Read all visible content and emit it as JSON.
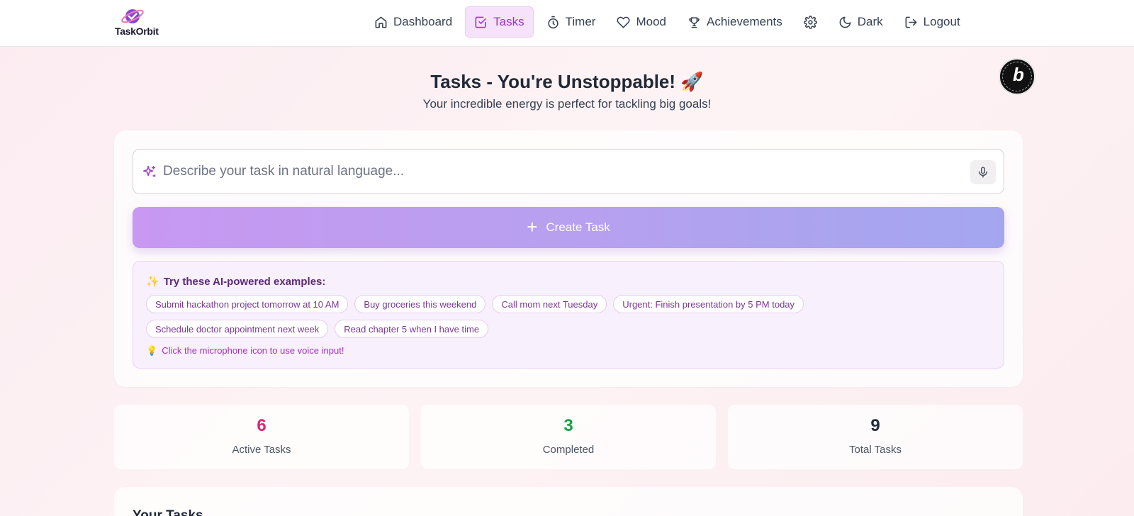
{
  "app": {
    "name": "TaskOrbit"
  },
  "nav": {
    "items": [
      {
        "label": "Dashboard",
        "icon": "home-icon",
        "active": false
      },
      {
        "label": "Tasks",
        "icon": "checkbox-icon",
        "active": true
      },
      {
        "label": "Timer",
        "icon": "stopwatch-icon",
        "active": false
      },
      {
        "label": "Mood",
        "icon": "heart-icon",
        "active": false
      },
      {
        "label": "Achievements",
        "icon": "trophy-icon",
        "active": false
      },
      {
        "label": "",
        "icon": "gear-icon",
        "active": false
      },
      {
        "label": "Dark",
        "icon": "moon-icon",
        "active": false
      },
      {
        "label": "Logout",
        "icon": "logout-icon",
        "active": false
      }
    ]
  },
  "header": {
    "title": "Tasks - You're Unstoppable! 🚀",
    "subtitle": "Your incredible energy is perfect for tackling big goals!"
  },
  "task_input": {
    "value": "",
    "placeholder": "Describe your task in natural language..."
  },
  "create_button": {
    "label": "Create Task"
  },
  "examples": {
    "title": "Try these AI-powered examples:",
    "title_icon": "✨",
    "chips": [
      "Submit hackathon project tomorrow at 10 AM",
      "Buy groceries this weekend",
      "Call mom next Tuesday",
      "Urgent: Finish presentation by 5 PM today",
      "Schedule doctor appointment next week",
      "Read chapter 5 when I have time"
    ],
    "hint_icon": "💡",
    "hint": "Click the microphone icon to use voice input!"
  },
  "stats": [
    {
      "value": "6",
      "label": "Active Tasks",
      "color": "#db2777"
    },
    {
      "value": "3",
      "label": "Completed",
      "color": "#16a34a"
    },
    {
      "value": "9",
      "label": "Total Tasks",
      "color": "#1f2937"
    }
  ],
  "tasks_section": {
    "heading": "Your Tasks"
  },
  "badge": {
    "letter": "b"
  },
  "colors": {
    "accent": "#9b36b7",
    "button_start": "#c898f2",
    "button_end": "#a3a6ef"
  }
}
